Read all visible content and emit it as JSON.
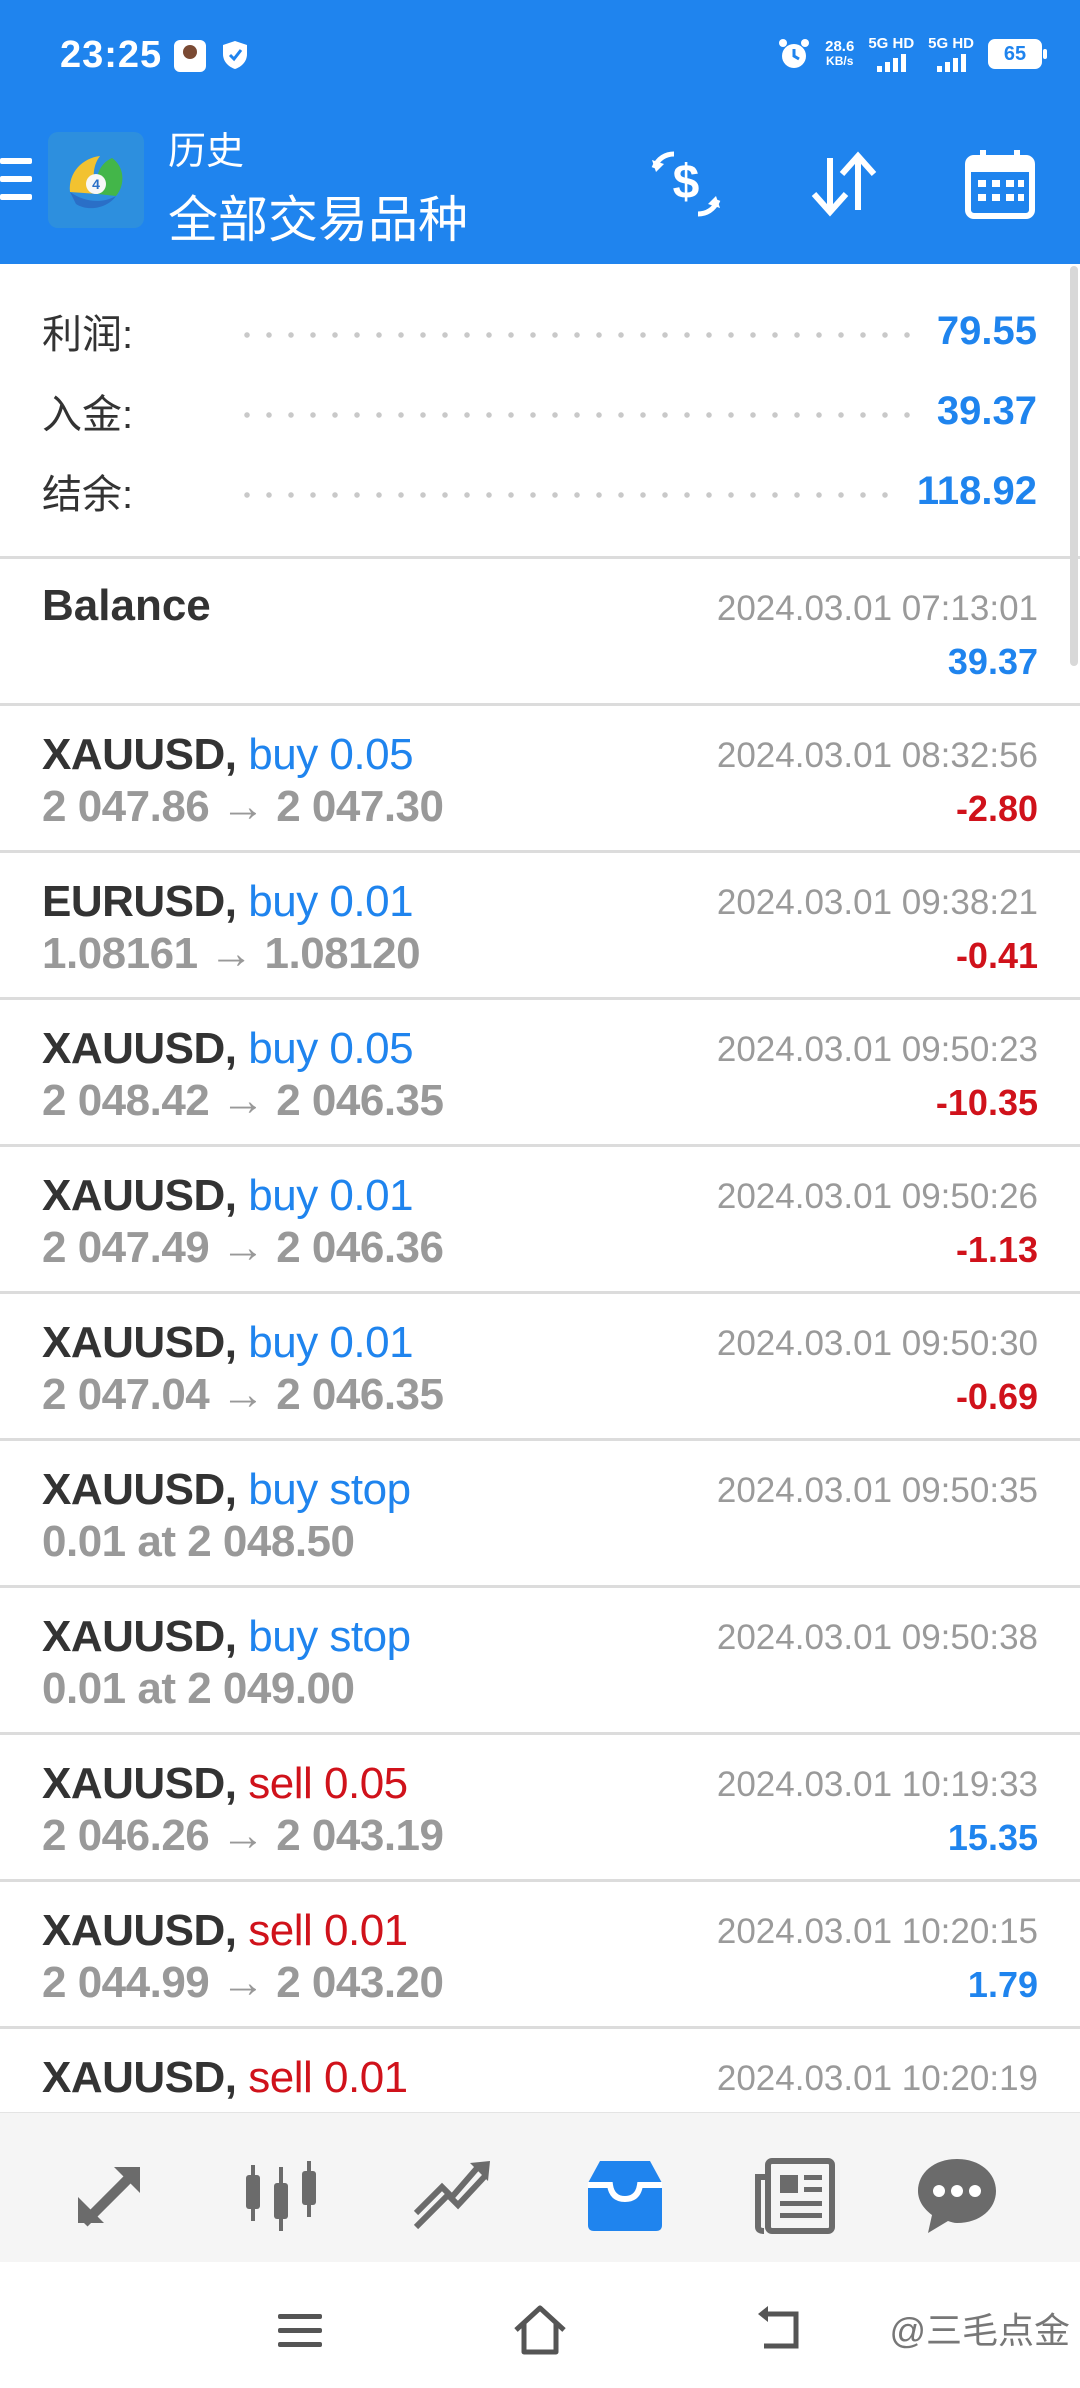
{
  "status_bar": {
    "time": "23:25",
    "net_speed_value": "28.6",
    "net_speed_unit": "KB/s",
    "sim1": "5G HD",
    "sim2": "5G HD",
    "battery": "65"
  },
  "header": {
    "title": "历史",
    "subtitle": "全部交易品种"
  },
  "summary": {
    "profit_label": "利润:",
    "profit_value": "79.55",
    "deposit_label": "入金:",
    "deposit_value": "39.37",
    "balance_label": "结余:",
    "balance_value": "118.92"
  },
  "balance_entry": {
    "label": "Balance",
    "time": "2024.03.01 07:13:01",
    "amount": "39.37"
  },
  "deals": [
    {
      "symbol": "XAUUSD,",
      "action": "buy 0.05",
      "action_color": "#1f84ee",
      "prices": "2 047.86 → 2 047.30",
      "time": "2024.03.01 08:32:56",
      "profit": "-2.80",
      "profit_color": "#d0121b"
    },
    {
      "symbol": "EURUSD,",
      "action": "buy 0.01",
      "action_color": "#1f84ee",
      "prices": "1.08161 → 1.08120",
      "time": "2024.03.01 09:38:21",
      "profit": "-0.41",
      "profit_color": "#d0121b"
    },
    {
      "symbol": "XAUUSD,",
      "action": "buy 0.05",
      "action_color": "#1f84ee",
      "prices": "2 048.42 → 2 046.35",
      "time": "2024.03.01 09:50:23",
      "profit": "-10.35",
      "profit_color": "#d0121b"
    },
    {
      "symbol": "XAUUSD,",
      "action": "buy 0.01",
      "action_color": "#1f84ee",
      "prices": "2 047.49 → 2 046.36",
      "time": "2024.03.01 09:50:26",
      "profit": "-1.13",
      "profit_color": "#d0121b"
    },
    {
      "symbol": "XAUUSD,",
      "action": "buy 0.01",
      "action_color": "#1f84ee",
      "prices": "2 047.04 → 2 046.35",
      "time": "2024.03.01 09:50:30",
      "profit": "-0.69",
      "profit_color": "#d0121b"
    },
    {
      "symbol": "XAUUSD,",
      "action": "buy stop",
      "action_color": "#1f84ee",
      "prices": "0.01 at 2 048.50",
      "time": "2024.03.01 09:50:35",
      "profit": "",
      "profit_color": "#d0121b"
    },
    {
      "symbol": "XAUUSD,",
      "action": "buy stop",
      "action_color": "#1f84ee",
      "prices": "0.01 at 2 049.00",
      "time": "2024.03.01 09:50:38",
      "profit": "",
      "profit_color": "#d0121b"
    },
    {
      "symbol": "XAUUSD,",
      "action": "sell 0.05",
      "action_color": "#d0121b",
      "prices": "2 046.26 → 2 043.19",
      "time": "2024.03.01 10:19:33",
      "profit": "15.35",
      "profit_color": "#1f84ee"
    },
    {
      "symbol": "XAUUSD,",
      "action": "sell 0.01",
      "action_color": "#d0121b",
      "prices": "2 044.99 → 2 043.20",
      "time": "2024.03.01 10:20:15",
      "profit": "1.79",
      "profit_color": "#1f84ee"
    },
    {
      "symbol": "XAUUSD,",
      "action": "sell 0.01",
      "action_color": "#d0121b",
      "prices": "",
      "time": "2024.03.01 10:20:19",
      "profit": "",
      "profit_color": "#1f84ee"
    }
  ],
  "bottom_nav": [
    {
      "name": "quotes-nav-icon",
      "active": false
    },
    {
      "name": "chart-nav-icon",
      "active": false
    },
    {
      "name": "trade-nav-icon",
      "active": false
    },
    {
      "name": "history-nav-icon",
      "active": true
    },
    {
      "name": "news-nav-icon",
      "active": false
    },
    {
      "name": "chat-nav-icon",
      "active": false
    }
  ],
  "watermark": "@三毛点金",
  "colors": {
    "accent": "#1f84ee",
    "loss": "#d0121b",
    "profit": "#1f84ee"
  }
}
